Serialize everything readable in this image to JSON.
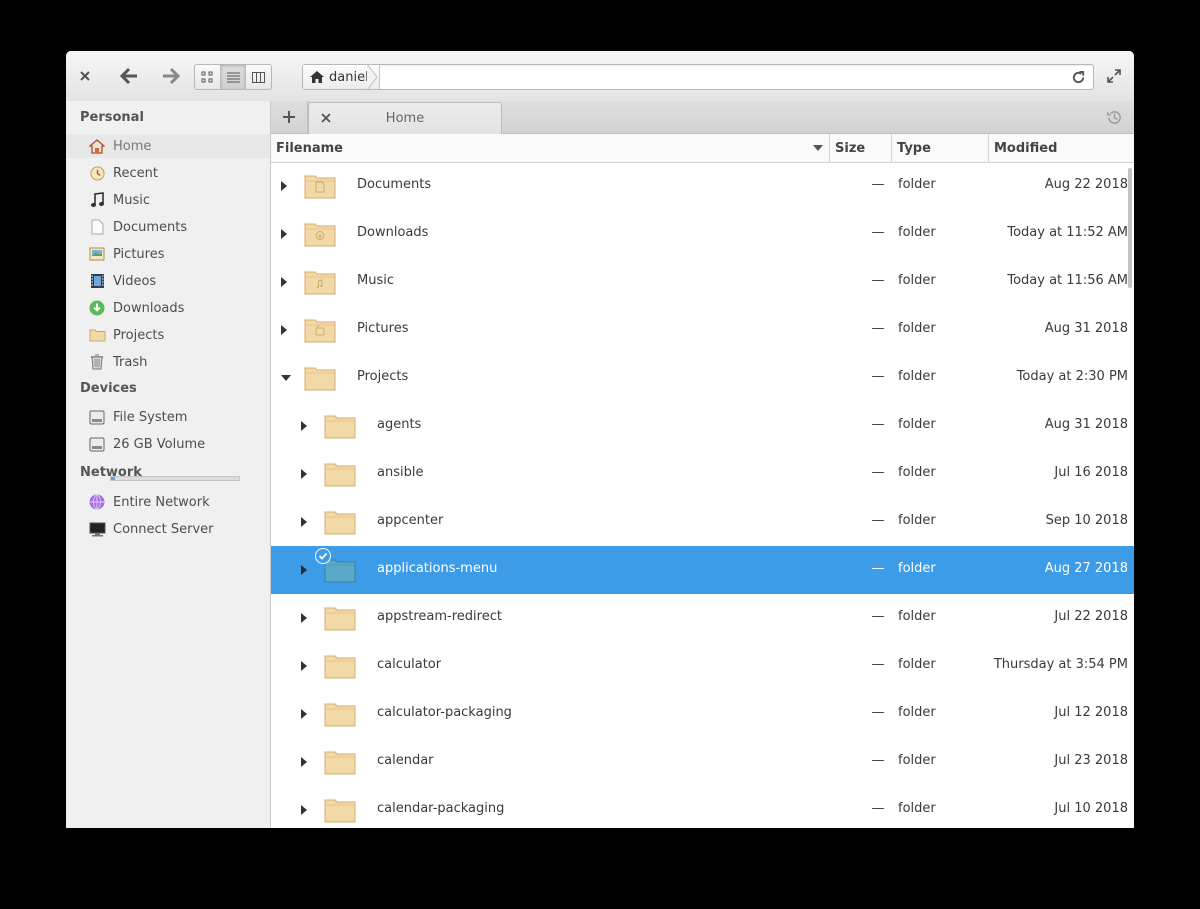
{
  "window": {
    "path_crumb": "daniel",
    "tab_label": "Home"
  },
  "sidebar": {
    "sections": [
      {
        "header": "Personal"
      },
      {
        "header": "Devices"
      },
      {
        "header": "Network"
      }
    ],
    "personal": [
      {
        "label": "Home",
        "icon": "home-icon"
      },
      {
        "label": "Recent",
        "icon": "recent-icon"
      },
      {
        "label": "Music",
        "icon": "music-icon"
      },
      {
        "label": "Documents",
        "icon": "documents-icon"
      },
      {
        "label": "Pictures",
        "icon": "pictures-icon"
      },
      {
        "label": "Videos",
        "icon": "videos-icon"
      },
      {
        "label": "Downloads",
        "icon": "downloads-icon"
      },
      {
        "label": "Projects",
        "icon": "folder-icon"
      },
      {
        "label": "Trash",
        "icon": "trash-icon"
      }
    ],
    "devices": [
      {
        "label": "File System",
        "icon": "drive-icon",
        "usage_fraction": 0.03
      },
      {
        "label": "26 GB Volume",
        "icon": "drive-icon"
      }
    ],
    "network": [
      {
        "label": "Entire Network",
        "icon": "network-icon"
      },
      {
        "label": "Connect Server",
        "icon": "server-icon"
      }
    ]
  },
  "columns": {
    "filename": "Filename",
    "size": "Size",
    "type": "Type",
    "modified": "Modified"
  },
  "files": [
    {
      "name": "Documents",
      "size": "—",
      "type": "folder",
      "modified": "Aug 22 2018",
      "level": 0,
      "emblem": "document"
    },
    {
      "name": "Downloads",
      "size": "—",
      "type": "folder",
      "modified": "Today at 11:52 AM",
      "level": 0,
      "emblem": "download"
    },
    {
      "name": "Music",
      "size": "—",
      "type": "folder",
      "modified": "Today at 11:56 AM",
      "level": 0,
      "emblem": "music"
    },
    {
      "name": "Pictures",
      "size": "—",
      "type": "folder",
      "modified": "Aug 31 2018",
      "level": 0,
      "emblem": "picture"
    },
    {
      "name": "Projects",
      "size": "—",
      "type": "folder",
      "modified": "Today at 2:30 PM",
      "level": 0,
      "expanded": true
    },
    {
      "name": "agents",
      "size": "—",
      "type": "folder",
      "modified": "Aug 31 2018",
      "level": 1
    },
    {
      "name": "ansible",
      "size": "—",
      "type": "folder",
      "modified": "Jul 16 2018",
      "level": 1
    },
    {
      "name": "appcenter",
      "size": "—",
      "type": "folder",
      "modified": "Sep 10 2018",
      "level": 1
    },
    {
      "name": "applications-menu",
      "size": "—",
      "type": "folder",
      "modified": "Aug 27 2018",
      "level": 1,
      "selected": true
    },
    {
      "name": "appstream-redirect",
      "size": "—",
      "type": "folder",
      "modified": "Jul 22 2018",
      "level": 1
    },
    {
      "name": "calculator",
      "size": "—",
      "type": "folder",
      "modified": "Thursday at 3:54 PM",
      "level": 1
    },
    {
      "name": "calculator-packaging",
      "size": "—",
      "type": "folder",
      "modified": "Jul 12 2018",
      "level": 1
    },
    {
      "name": "calendar",
      "size": "—",
      "type": "folder",
      "modified": "Jul 23 2018",
      "level": 1
    },
    {
      "name": "calendar-packaging",
      "size": "—",
      "type": "folder",
      "modified": "Jul 10 2018",
      "level": 1
    }
  ],
  "colors": {
    "selection": "#3d9ce8",
    "folder": "#f3d9a8",
    "folder_selected": "#5aa9c9"
  }
}
